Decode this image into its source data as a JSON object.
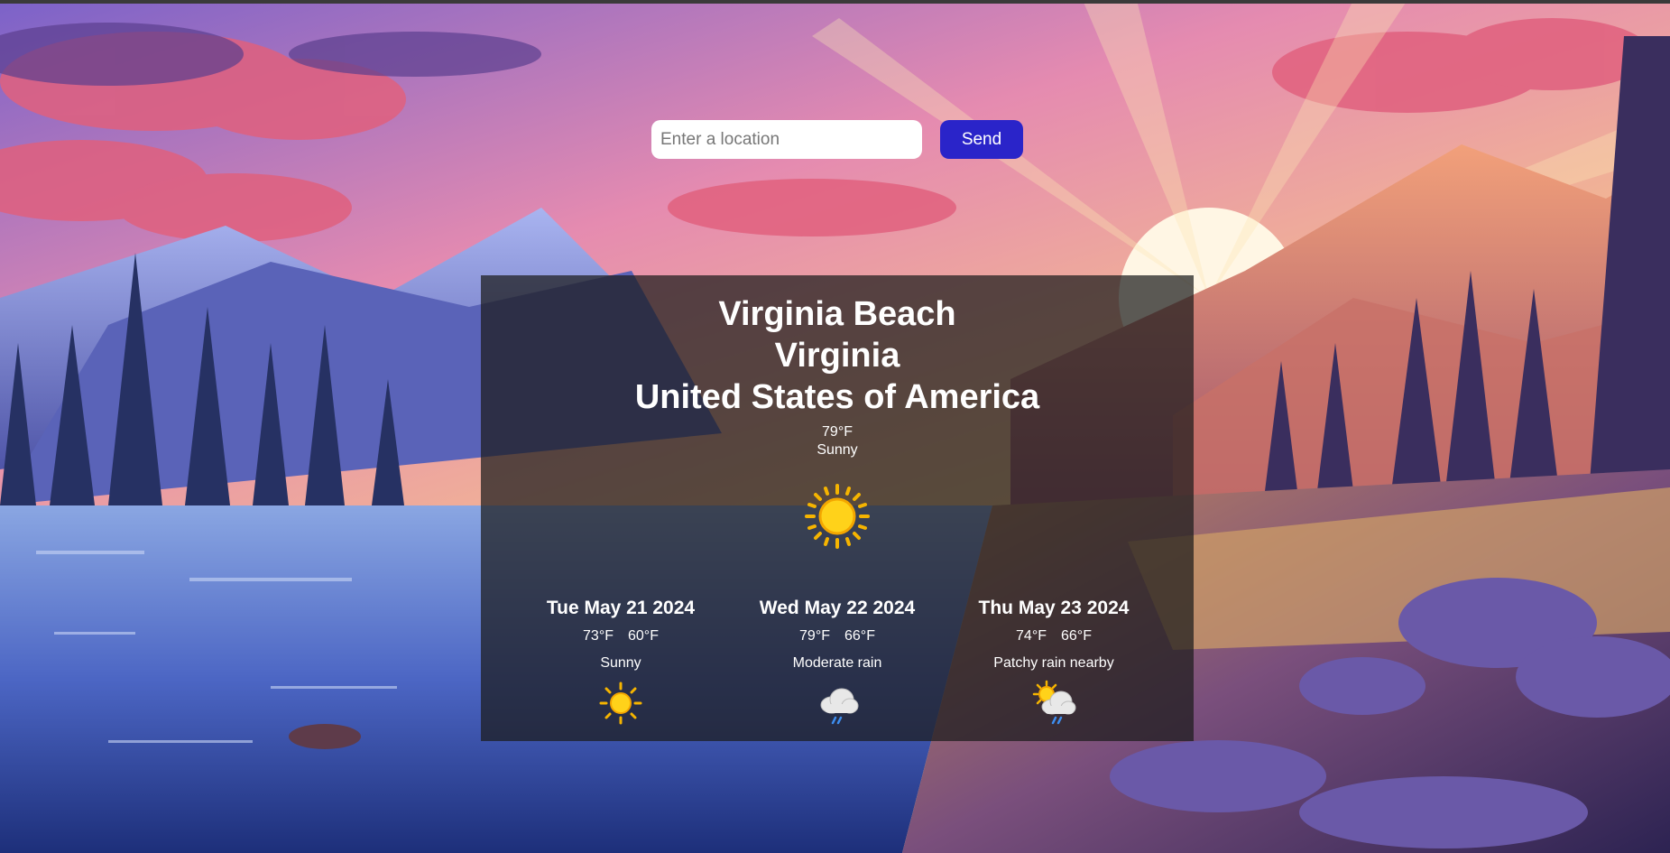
{
  "search": {
    "placeholder": "Enter a location",
    "value": "",
    "send_label": "Send"
  },
  "location": {
    "city": "Virginia Beach",
    "region": "Virginia",
    "country": "United States of America"
  },
  "current": {
    "temperature": "79°F",
    "condition": "Sunny",
    "icon": "sun-icon"
  },
  "forecast": [
    {
      "date": "Tue May 21 2024",
      "high": "73°F",
      "low": "60°F",
      "condition": "Sunny",
      "icon": "sun-icon"
    },
    {
      "date": "Wed May 22 2024",
      "high": "79°F",
      "low": "66°F",
      "condition": "Moderate rain",
      "icon": "rain-cloud-icon"
    },
    {
      "date": "Thu May 23 2024",
      "high": "74°F",
      "low": "66°F",
      "condition": "Patchy rain nearby",
      "icon": "sun-rain-cloud-icon"
    }
  ],
  "colors": {
    "accent": "#2a24c9",
    "card_background": "rgba(28,28,28,0.72)",
    "text": "#ffffff"
  }
}
